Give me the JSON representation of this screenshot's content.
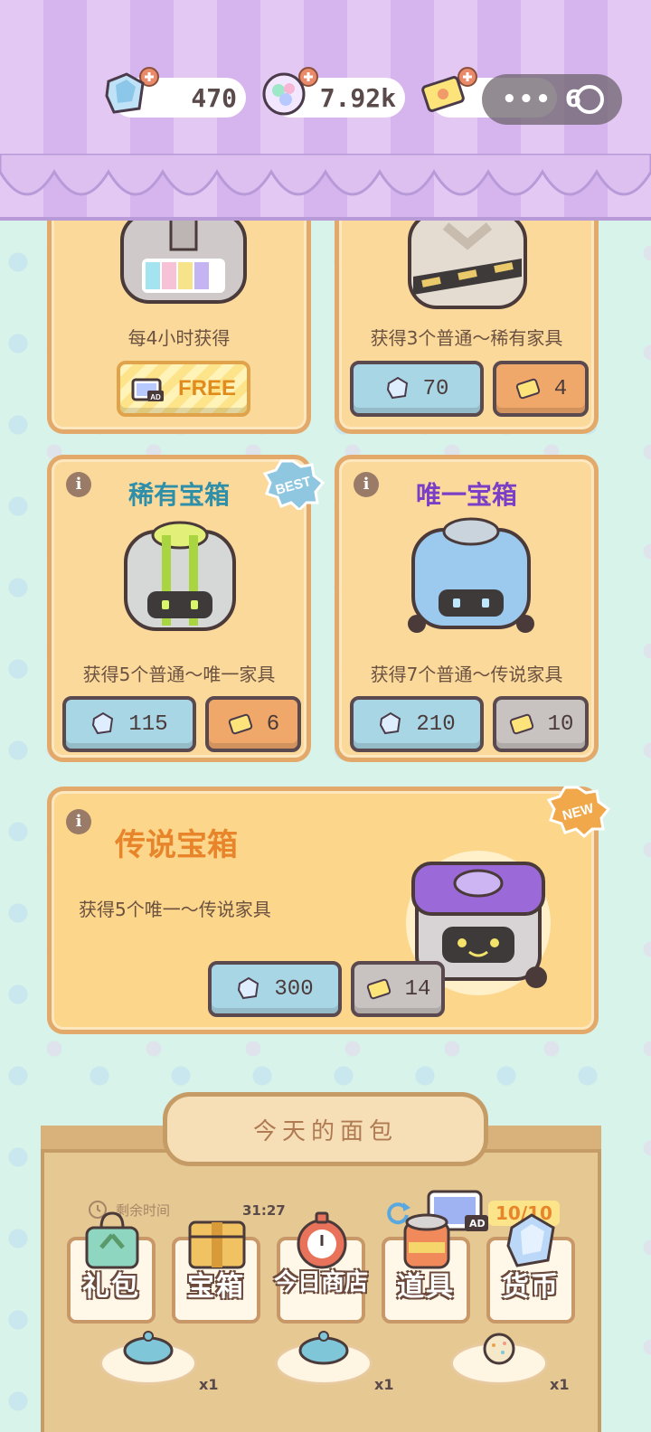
{
  "top_bar": {
    "gems": "470",
    "orbs": "7.92k",
    "tickets_partial": "6"
  },
  "cards": {
    "card1": {
      "desc": "每4小时获得",
      "button": "FREE",
      "ad_label": "AD"
    },
    "card2": {
      "desc": "获得3个普通～稀有家具",
      "gem_price": "70",
      "ticket_price": "4"
    },
    "rare": {
      "title": "稀有宝箱",
      "badge": "BEST",
      "desc": "获得5个普通～唯一家具",
      "gem_price": "115",
      "ticket_price": "6"
    },
    "unique": {
      "title": "唯一宝箱",
      "desc": "获得7个普通～传说家具",
      "gem_price": "210",
      "ticket_price": "10"
    },
    "legend": {
      "title": "传说宝箱",
      "badge": "NEW",
      "desc": "获得5个唯一～传说家具",
      "gem_price": "300",
      "ticket_price": "14"
    }
  },
  "bottom": {
    "sign": "今天的面包",
    "timer_label": "剩余时间",
    "timer_value": "31:27",
    "ad_label": "AD",
    "ad_count": "10/10",
    "tabs": [
      {
        "label": "礼包"
      },
      {
        "label": "宝箱"
      },
      {
        "label": "今日商店"
      },
      {
        "label": "道具"
      },
      {
        "label": "货币"
      }
    ],
    "items": [
      {
        "count": "x1"
      },
      {
        "count": "x1"
      },
      {
        "count": "x1"
      }
    ]
  },
  "colors": {
    "rare_title": "#2f8fa8",
    "unique_title": "#7a3fc6",
    "legend_title": "#e8852a"
  }
}
